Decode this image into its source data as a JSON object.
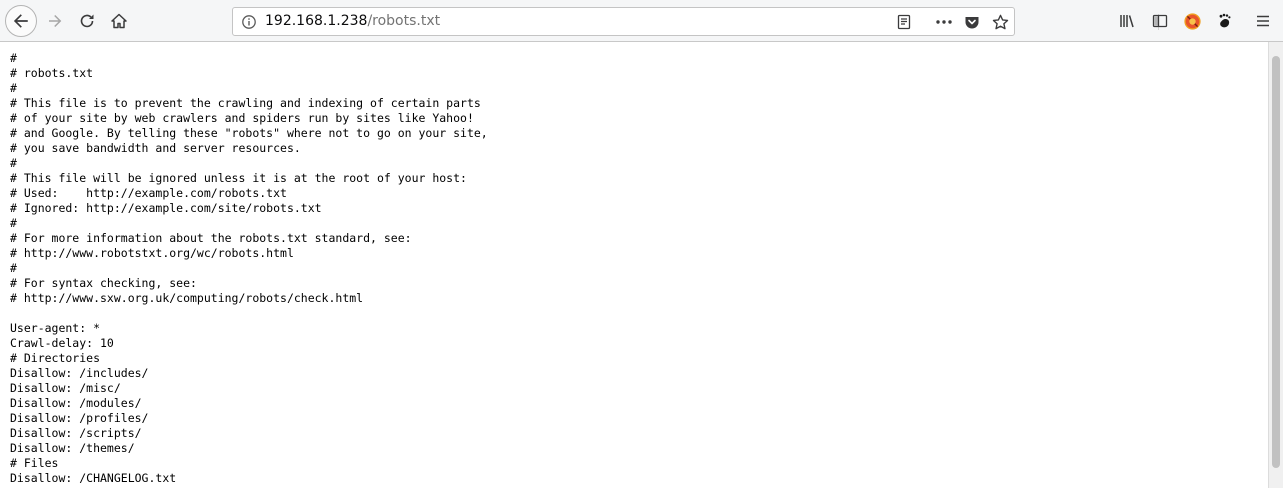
{
  "browser": {
    "url_host": "192.168.1.238",
    "url_path": "/robots.txt"
  },
  "icons": {
    "back": "arrow-left-icon",
    "forward": "arrow-right-icon",
    "reload": "reload-icon",
    "home": "home-icon",
    "site_info": "info-icon",
    "reader": "reader-view-icon",
    "page_actions": "more-horizontal-icon",
    "pocket": "pocket-icon",
    "bookmark": "star-icon",
    "library": "library-icon",
    "sidebar": "sidebar-icon",
    "extension": "blocked-extension-icon",
    "gnome": "gnome-foot-icon",
    "menu": "hamburger-menu-icon"
  },
  "colors": {
    "toolbar_bg": "#f5f6f7",
    "url_path": "#737373",
    "extension_red": "#e8542b",
    "extension_ring": "#f0a020"
  },
  "document": {
    "lines": [
      "#",
      "# robots.txt",
      "#",
      "# This file is to prevent the crawling and indexing of certain parts",
      "# of your site by web crawlers and spiders run by sites like Yahoo!",
      "# and Google. By telling these \"robots\" where not to go on your site,",
      "# you save bandwidth and server resources.",
      "#",
      "# This file will be ignored unless it is at the root of your host:",
      "# Used:    http://example.com/robots.txt",
      "# Ignored: http://example.com/site/robots.txt",
      "#",
      "# For more information about the robots.txt standard, see:",
      "# http://www.robotstxt.org/wc/robots.html",
      "#",
      "# For syntax checking, see:",
      "# http://www.sxw.org.uk/computing/robots/check.html",
      "",
      "User-agent: *",
      "Crawl-delay: 10",
      "# Directories",
      "Disallow: /includes/",
      "Disallow: /misc/",
      "Disallow: /modules/",
      "Disallow: /profiles/",
      "Disallow: /scripts/",
      "Disallow: /themes/",
      "# Files",
      "Disallow: /CHANGELOG.txt"
    ]
  }
}
